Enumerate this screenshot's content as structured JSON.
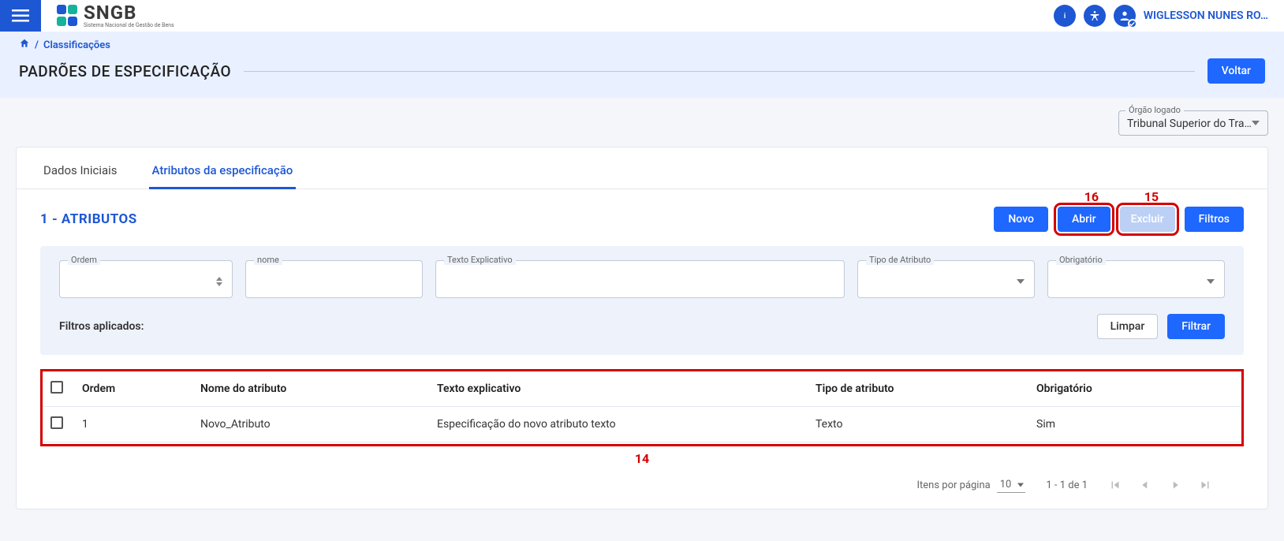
{
  "header": {
    "logo_text": "SNGB",
    "logo_subtitle": "Sistema Nacional de Gestão de Bens",
    "username": "WIGLESSON NUNES RO…"
  },
  "breadcrumb": {
    "item1": "Classificações"
  },
  "page_title": "PADRÕES DE ESPECIFICAÇÃO",
  "buttons": {
    "voltar": "Voltar",
    "novo": "Novo",
    "abrir": "Abrir",
    "excluir": "Excluir",
    "filtros": "Filtros",
    "limpar": "Limpar",
    "filtrar": "Filtrar"
  },
  "orgao": {
    "label": "Órgão logado",
    "value": "Tribunal Superior do Tra…"
  },
  "tabs": {
    "t1": "Dados Iniciais",
    "t2": "Atributos da especificação"
  },
  "section": {
    "title": "1 - ATRIBUTOS"
  },
  "filter_labels": {
    "ordem": "Ordem",
    "nome": "nome",
    "texto": "Texto Explicativo",
    "tipo": "Tipo de Atributo",
    "obrig": "Obrigatório",
    "applied": "Filtros aplicados:"
  },
  "table": {
    "headers": {
      "ordem": "Ordem",
      "nome": "Nome do atributo",
      "texto": "Texto explicativo",
      "tipo": "Tipo de atributo",
      "obrig": "Obrigatório"
    },
    "rows": [
      {
        "ordem": "1",
        "nome": "Novo_Atributo",
        "texto": "Especificação do novo atributo texto",
        "tipo": "Texto",
        "obrig": "Sim"
      }
    ]
  },
  "pagination": {
    "items_label": "Itens por página",
    "page_size": "10",
    "range": "1 - 1 de 1"
  },
  "annotations": {
    "a14": "14",
    "a15": "15",
    "a16": "16"
  }
}
